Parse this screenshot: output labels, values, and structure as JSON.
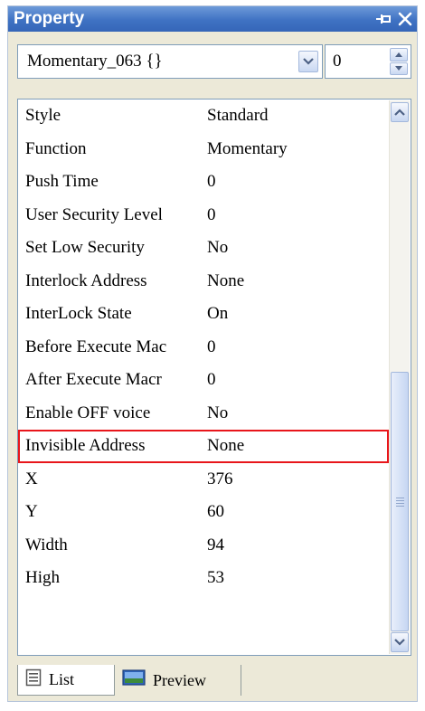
{
  "window": {
    "title": "Property"
  },
  "titlebar_icons": [
    "pin-icon",
    "close-icon"
  ],
  "selector": {
    "object_value": "Momentary_063 {}",
    "spin_value": "0"
  },
  "properties": [
    {
      "name": "Style",
      "value": "Standard"
    },
    {
      "name": "Function",
      "value": "Momentary"
    },
    {
      "name": "Push Time",
      "value": "0"
    },
    {
      "name": "User Security Level",
      "value": "0"
    },
    {
      "name": "Set Low Security",
      "value": "No"
    },
    {
      "name": "Interlock Address",
      "value": "None"
    },
    {
      "name": "InterLock State",
      "value": "On"
    },
    {
      "name": "Before Execute Mac",
      "value": "0"
    },
    {
      "name": "After Execute Macr",
      "value": "0"
    },
    {
      "name": "Enable OFF voice",
      "value": "No"
    },
    {
      "name": "Invisible Address",
      "value": "None"
    },
    {
      "name": "X",
      "value": "376"
    },
    {
      "name": "Y",
      "value": "60"
    },
    {
      "name": "Width",
      "value": "94"
    },
    {
      "name": "High",
      "value": "53"
    }
  ],
  "highlighted_row": "Invisible Address",
  "tabs": [
    {
      "label": "List",
      "icon": "list-icon",
      "active": true
    },
    {
      "label": "Preview",
      "icon": "preview-icon",
      "active": false
    }
  ],
  "colors": {
    "titlebar": "#3f72c3",
    "highlight_border": "#e8161b",
    "panel_bg": "#ece9d8"
  }
}
